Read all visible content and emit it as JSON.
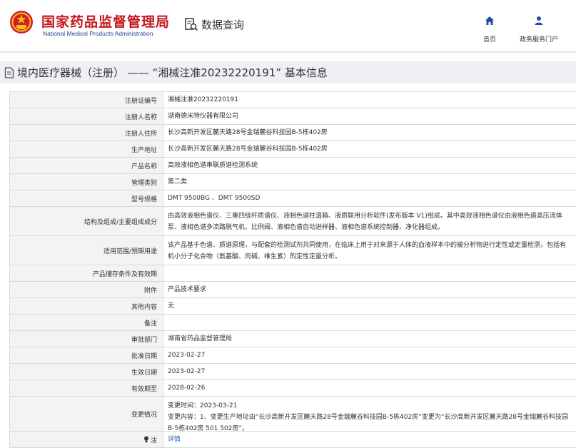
{
  "header": {
    "brand_cn": "国家药品监督管理局",
    "brand_en": "National Medical Products Administration",
    "query_label": "数据查询",
    "nav": [
      {
        "label": "首页",
        "icon": "home-icon"
      },
      {
        "label": "政务服务门户",
        "icon": "user-icon"
      }
    ]
  },
  "page_title": "境内医疗器械（注册） —— “湘械注准20232220191” 基本信息",
  "rows": [
    {
      "label": "注册证编号",
      "value": "湘械注准20232220191"
    },
    {
      "label": "注册人名称",
      "value": "湖南德米特仪器有限公司"
    },
    {
      "label": "注册人住所",
      "value": "长沙高新开发区麓天路28号金瑞麓谷科技园B-5栋402房"
    },
    {
      "label": "生产地址",
      "value": "长沙高新开发区麓天路28号金瑞麓谷科技园B-5栋402房"
    },
    {
      "label": "产品名称",
      "value": "高效液相色谱串联质谱检测系统"
    },
    {
      "label": "管理类别",
      "value": "第二类"
    },
    {
      "label": "型号规格",
      "value": "DMT 9500BG 、DMT 9500SD"
    },
    {
      "label": "结构及组成/主要组成成分",
      "value": "由高效液相色谱仪、三重四级杆质谱仪、液相色谱柱温箱、液质联用分析软件(发布版本 V1)组成。其中高效液相色谱仪由液相色谱高压流体泵、液相色谱多流路脱气机、比例阀、液相色谱自动进样器、液相色谱系统控制器、净化器组成。"
    },
    {
      "label": "适用范围/预期用途",
      "value": "该产品基于色谱、质谱原理，与配套的检测试剂共同使用，在临床上用于对来源于人体的血液样本中的被分析物进行定性或定量检测，包括有机小分子化合物（氨基酸、肉碱、维生素）的定性定量分析。"
    },
    {
      "label": "产品储存条件及有效期",
      "value": ""
    },
    {
      "label": "附件",
      "value": "产品技术要求"
    },
    {
      "label": "其他内容",
      "value": "无"
    },
    {
      "label": "备注",
      "value": ""
    },
    {
      "label": "审批部门",
      "value": "湖南省药品监督管理局"
    },
    {
      "label": "批准日期",
      "value": "2023-02-27"
    },
    {
      "label": "生效日期",
      "value": "2023-02-27"
    },
    {
      "label": "有效期至",
      "value": "2028-02-26"
    },
    {
      "label": "变更情况",
      "value": "变更时间：2023-03-21\n变更内容：1、变更生产地址由“长沙高新开发区麓天路28号金瑞麓谷科技园B-5栋402房”变更为“长沙高新开发区麓天路28号金瑞麓谷科技园B-5栋402房 501 502房”。"
    },
    {
      "label": "注",
      "value": "详情"
    }
  ],
  "colors": {
    "brand_red": "#c4161c",
    "brand_blue": "#2a3f8f",
    "nav_icon_blue": "#1f4fa3",
    "link_blue": "#2a64b8",
    "label_bg": "#f2f3f5",
    "title_bar_bg": "#eef0f3"
  }
}
